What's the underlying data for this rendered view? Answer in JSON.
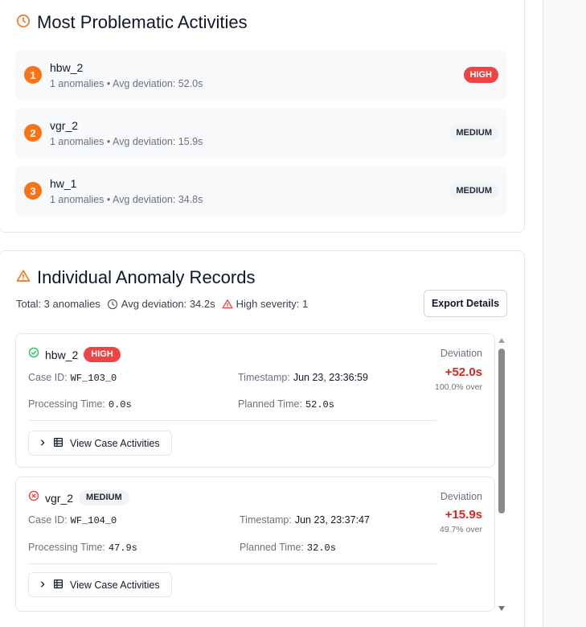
{
  "problematic": {
    "title": "Most Problematic Activities",
    "items": [
      {
        "rank": "1",
        "name": "hbw_2",
        "sub": "1 anomalies • Avg deviation: 52.0s",
        "severity": "HIGH"
      },
      {
        "rank": "2",
        "name": "vgr_2",
        "sub": "1 anomalies • Avg deviation: 15.9s",
        "severity": "MEDIUM"
      },
      {
        "rank": "3",
        "name": "hw_1",
        "sub": "1 anomalies • Avg deviation: 34.8s",
        "severity": "MEDIUM"
      }
    ]
  },
  "records": {
    "title": "Individual Anomaly Records",
    "summary": {
      "total": "Total: 3 anomalies",
      "avg": "Avg deviation: 34.2s",
      "high": "High severity: 1"
    },
    "export_label": "Export Details",
    "labels": {
      "case_id": "Case ID:",
      "timestamp": "Timestamp:",
      "processing": "Processing Time:",
      "planned": "Planned Time:",
      "deviation": "Deviation",
      "view": "View Case Activities"
    },
    "items": [
      {
        "status_icon": "check-circle-icon",
        "name": "hbw_2",
        "severity": "HIGH",
        "case_id": "WF_103_0",
        "timestamp": "Jun 23, 23:36:59",
        "processing": "0.0s",
        "planned": "52.0s",
        "deviation": "+52.0s",
        "pct": "100.0% over"
      },
      {
        "status_icon": "x-circle-icon",
        "name": "vgr_2",
        "severity": "MEDIUM",
        "case_id": "WF_104_0",
        "timestamp": "Jun 23, 23:37:47",
        "processing": "47.9s",
        "planned": "32.0s",
        "deviation": "+15.9s",
        "pct": "49.7% over"
      }
    ]
  },
  "colors": {
    "accent": "#f97316",
    "high": "#ef4444",
    "deviation": "#dc2626",
    "success": "#22c55e"
  }
}
